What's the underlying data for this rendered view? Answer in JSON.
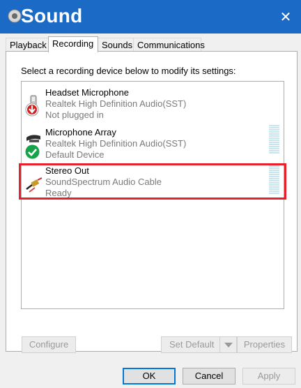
{
  "window": {
    "title": "Sound",
    "close_glyph": "✕"
  },
  "tabs": [
    {
      "label": "Playback",
      "active": false
    },
    {
      "label": "Recording",
      "active": true
    },
    {
      "label": "Sounds",
      "active": false
    },
    {
      "label": "Communications",
      "active": false
    }
  ],
  "instruction": "Select a recording device below to modify its settings:",
  "devices": [
    {
      "name": "Headset Microphone",
      "driver": "Realtek High Definition Audio(SST)",
      "status": "Not plugged in",
      "icon": "headset-microphone-icon",
      "status_icon": "red-down-arrow-icon",
      "level": 0
    },
    {
      "name": "Microphone Array",
      "driver": "Realtek High Definition Audio(SST)",
      "status": "Default Device",
      "icon": "microphone-array-icon",
      "status_icon": "green-check-icon",
      "level": 0
    },
    {
      "name": "Stereo Out",
      "driver": "SoundSpectrum Audio Cable",
      "status": "Ready",
      "icon": "audio-cable-icon",
      "status_icon": "",
      "level": 0
    }
  ],
  "buttons": {
    "configure": "Configure",
    "set_default": "Set Default",
    "properties": "Properties",
    "ok": "OK",
    "cancel": "Cancel",
    "apply": "Apply"
  },
  "colors": {
    "titlebar": "#1b6ac6",
    "highlight": "#e8202a",
    "level_meter": "#c7e5ec"
  }
}
